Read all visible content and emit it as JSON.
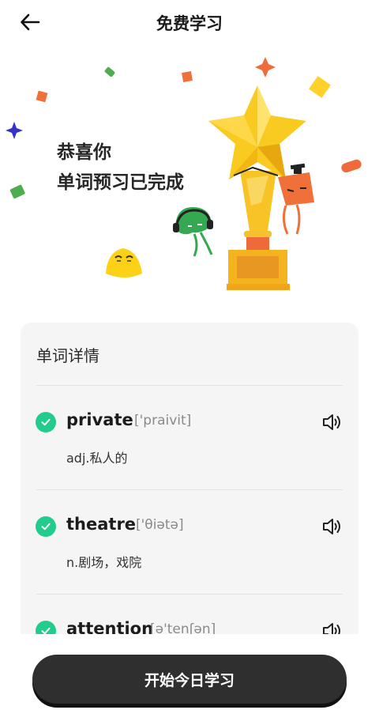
{
  "header": {
    "title": "免费学习"
  },
  "hero": {
    "line1": "恭喜你",
    "line2": "单词预习已完成"
  },
  "card": {
    "title": "单词详情",
    "words": [
      {
        "word": "private",
        "phonetic": "['praivit]",
        "meaning": "adj.私人的"
      },
      {
        "word": "theatre",
        "phonetic": "['θiətə]",
        "meaning": "n.剧场，戏院"
      },
      {
        "word": "attention",
        "phonetic": "[ə'tenʃən]",
        "meaning": ""
      }
    ]
  },
  "bottom": {
    "start_label": "开始今日学习"
  },
  "colors": {
    "accent_green": "#22cc8d",
    "button_dark": "#2f2f2f",
    "trophy_yellow": "#f7c325"
  }
}
